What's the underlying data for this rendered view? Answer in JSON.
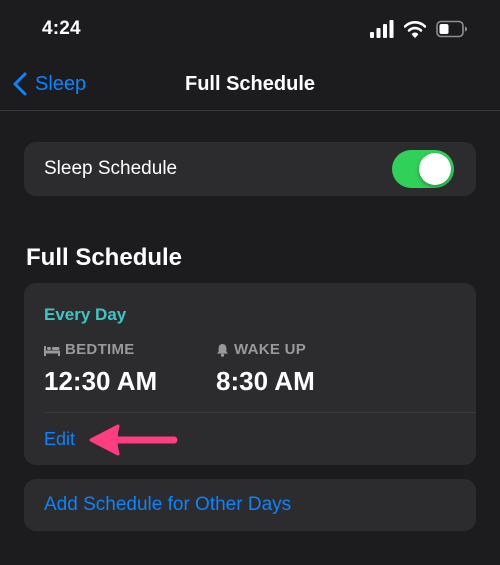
{
  "status_bar": {
    "time": "4:24",
    "icons": [
      "signal-icon",
      "wifi-icon",
      "battery-icon"
    ]
  },
  "nav": {
    "back_label": "Sleep",
    "title": "Full Schedule"
  },
  "sleep_schedule": {
    "label": "Sleep Schedule",
    "enabled": true
  },
  "section_title": "Full Schedule",
  "schedule": {
    "frequency": "Every Day",
    "bedtime_caption": "BEDTIME",
    "bedtime_value": "12:30 AM",
    "wakeup_caption": "WAKE UP",
    "wakeup_value": "8:30 AM",
    "edit_label": "Edit"
  },
  "add_schedule_label": "Add Schedule for Other Days",
  "colors": {
    "background": "#1c1c1e",
    "card": "#2c2c2e",
    "accent_blue": "#0a84ff",
    "toggle_green": "#30d158",
    "teal": "#3ec6c6",
    "annotation_arrow": "#ff3d7f"
  }
}
